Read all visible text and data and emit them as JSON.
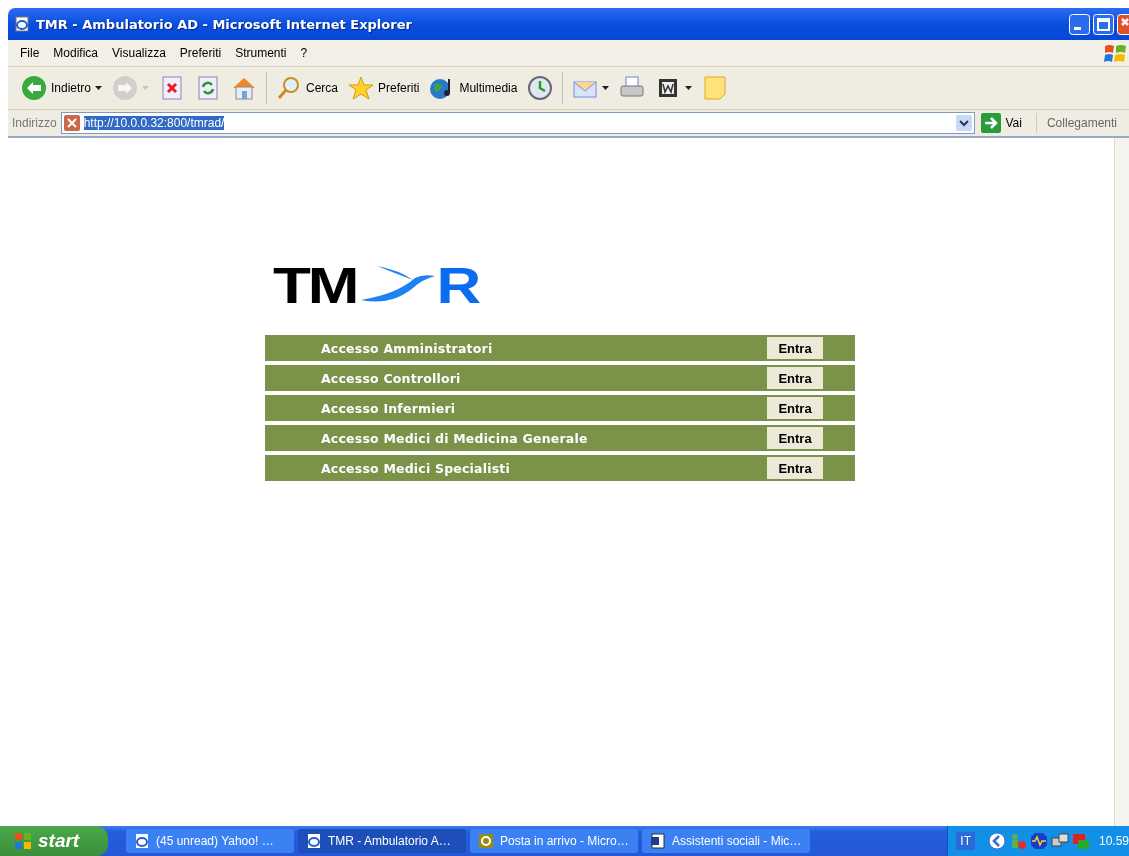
{
  "window": {
    "title": "TMR - Ambulatorio AD - Microsoft Internet Explorer"
  },
  "menu": [
    "File",
    "Modifica",
    "Visualizza",
    "Preferiti",
    "Strumenti",
    "?"
  ],
  "toolbar": [
    {
      "label": "Indietro",
      "dropdown": true,
      "disabled": false
    },
    {
      "dropdown": true,
      "disabled": true
    },
    {
      "dropdown": false,
      "disabled": false
    },
    {
      "dropdown": false,
      "disabled": false
    },
    {
      "dropdown": false,
      "disabled": false
    },
    {
      "label": "Cerca",
      "dropdown": false,
      "disabled": false
    },
    {
      "label": "Preferiti",
      "dropdown": false,
      "disabled": false
    },
    {
      "label": "Multimedia",
      "dropdown": false,
      "disabled": false
    },
    {
      "dropdown": false,
      "disabled": false
    },
    {
      "dropdown": true,
      "disabled": false
    },
    {
      "dropdown": false,
      "disabled": false
    },
    {
      "dropdown": true,
      "disabled": false
    },
    {
      "dropdown": false,
      "disabled": false
    }
  ],
  "address": {
    "label": "Indirizzo",
    "value": "http://10.0.0.32:800/tmrad/",
    "go": "Vai",
    "links": "Collegamenti"
  },
  "logo": {
    "left": "TM",
    "right": "R"
  },
  "access_rows": [
    {
      "label": "Accesso Amministratori",
      "button": "Entra"
    },
    {
      "label": "Accesso Controllori",
      "button": "Entra"
    },
    {
      "label": "Accesso Infermieri",
      "button": "Entra"
    },
    {
      "label": "Accesso Medici di Medicina Generale",
      "button": "Entra"
    },
    {
      "label": "Accesso Medici Specialisti",
      "button": "Entra"
    }
  ],
  "taskbar": {
    "start": "start",
    "tasks": [
      {
        "label": "(45 unread) Yahoo! …",
        "selected": false
      },
      {
        "label": "TMR - Ambulatorio A…",
        "selected": true
      },
      {
        "label": "Posta in arrivo - Micro…",
        "selected": false
      },
      {
        "label": "Assistenti sociali - Mic…",
        "selected": false
      }
    ],
    "language": "IT",
    "clock": "10.59"
  }
}
